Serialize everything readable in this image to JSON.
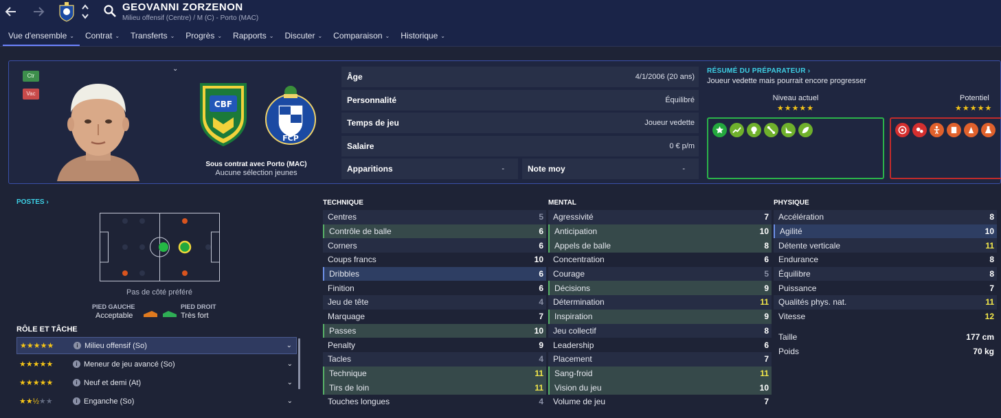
{
  "header": {
    "player_name": "GEOVANNI ZORZENON",
    "player_subtitle": "Milieu offensif (Centre) / M (C) - Porto (MAC)"
  },
  "tabs": [
    {
      "label": "Vue d'ensemble",
      "active": true
    },
    {
      "label": "Contrat"
    },
    {
      "label": "Transferts"
    },
    {
      "label": "Progrès"
    },
    {
      "label": "Rapports"
    },
    {
      "label": "Discuter"
    },
    {
      "label": "Comparaison"
    },
    {
      "label": "Historique"
    }
  ],
  "hero": {
    "badge_ctr": "Ctr",
    "badge_vac": "Vac",
    "flag_brazil_text": "CBF",
    "crest_porto_text": "FCP",
    "contract": "Sous contrat avec Porto (MAC)",
    "youth": "Aucune sélection jeunes"
  },
  "info": {
    "age_label": "Âge",
    "age_value": "4/1/2006 (20 ans)",
    "personality_label": "Personnalité",
    "personality_value": "Équilibré",
    "playtime_label": "Temps de jeu",
    "playtime_value": "Joueur vedette",
    "salary_label": "Salaire",
    "salary_value": "0 € p/m",
    "apps_label": "Apparitions",
    "apps_value": "-",
    "rating_label": "Note moy",
    "rating_value": "-"
  },
  "scout": {
    "title": "RÉSUMÉ DU PRÉPARATEUR",
    "summary": "Joueur vedette mais pourrait encore progresser",
    "current_label": "Niveau actuel",
    "current_stars": "★★★★★",
    "potential_label": "Potentiel",
    "potential_stars": "★★★★★",
    "strength_icons": [
      "star-icon",
      "trend-icon",
      "head-icon",
      "bone-icon",
      "boot-icon",
      "leaf-icon"
    ],
    "weakness_icons": [
      "target-icon",
      "ball-icon",
      "figure-icon",
      "document-icon",
      "cone-icon",
      "flask-icon"
    ]
  },
  "colors": {
    "strength": "#2bb34a",
    "weakness": "#c22b2b",
    "accent": "#3ed1e6",
    "highlight_value": "#f3e84a"
  },
  "positions": {
    "title": "POSTES",
    "no_side": "Pas de côté préféré",
    "left_foot_label": "PIED GAUCHE",
    "left_foot_value": "Acceptable",
    "right_foot_label": "PIED DROIT",
    "right_foot_value": "Très fort"
  },
  "roles": {
    "title": "RÔLE ET TÂCHE",
    "items": [
      {
        "name": "Milieu offensif (So)",
        "stars": 5,
        "active": true
      },
      {
        "name": "Meneur de jeu avancé (So)",
        "stars": 5
      },
      {
        "name": "Neuf et demi (At)",
        "stars": 5
      },
      {
        "name": "Enganche (So)",
        "stars": 2.5
      }
    ]
  },
  "technique": {
    "title": "TECHNIQUE",
    "rows": [
      {
        "name": "Centres",
        "value": "5",
        "tone": "low"
      },
      {
        "name": "Contrôle de balle",
        "value": "6",
        "hl": "green"
      },
      {
        "name": "Corners",
        "value": "6"
      },
      {
        "name": "Coups francs",
        "value": "10"
      },
      {
        "name": "Dribbles",
        "value": "6",
        "hl": "blue"
      },
      {
        "name": "Finition",
        "value": "6"
      },
      {
        "name": "Jeu de tête",
        "value": "4",
        "tone": "low"
      },
      {
        "name": "Marquage",
        "value": "7"
      },
      {
        "name": "Passes",
        "value": "10",
        "hl": "green"
      },
      {
        "name": "Penalty",
        "value": "9"
      },
      {
        "name": "Tacles",
        "value": "4",
        "tone": "low"
      },
      {
        "name": "Technique",
        "value": "11",
        "tone": "high",
        "hl": "green"
      },
      {
        "name": "Tirs de loin",
        "value": "11",
        "tone": "high",
        "hl": "green"
      },
      {
        "name": "Touches longues",
        "value": "4",
        "tone": "low"
      }
    ]
  },
  "mental": {
    "title": "MENTAL",
    "rows": [
      {
        "name": "Agressivité",
        "value": "7"
      },
      {
        "name": "Anticipation",
        "value": "10",
        "hl": "green"
      },
      {
        "name": "Appels de balle",
        "value": "8",
        "hl": "green"
      },
      {
        "name": "Concentration",
        "value": "6"
      },
      {
        "name": "Courage",
        "value": "5",
        "tone": "low"
      },
      {
        "name": "Décisions",
        "value": "9",
        "hl": "green"
      },
      {
        "name": "Détermination",
        "value": "11",
        "tone": "high"
      },
      {
        "name": "Inspiration",
        "value": "9",
        "hl": "green"
      },
      {
        "name": "Jeu collectif",
        "value": "8"
      },
      {
        "name": "Leadership",
        "value": "6"
      },
      {
        "name": "Placement",
        "value": "7"
      },
      {
        "name": "Sang-froid",
        "value": "11",
        "tone": "high",
        "hl": "green"
      },
      {
        "name": "Vision du jeu",
        "value": "10",
        "hl": "green"
      },
      {
        "name": "Volume de jeu",
        "value": "7"
      }
    ]
  },
  "physique": {
    "title": "PHYSIQUE",
    "rows": [
      {
        "name": "Accélération",
        "value": "8"
      },
      {
        "name": "Agilité",
        "value": "10",
        "hl": "blue"
      },
      {
        "name": "Détente verticale",
        "value": "11",
        "tone": "high"
      },
      {
        "name": "Endurance",
        "value": "8"
      },
      {
        "name": "Équilibre",
        "value": "8"
      },
      {
        "name": "Puissance",
        "value": "7"
      },
      {
        "name": "Qualités phys. nat.",
        "value": "11",
        "tone": "high"
      },
      {
        "name": "Vitesse",
        "value": "12",
        "tone": "high"
      }
    ],
    "height_label": "Taille",
    "height_value": "177 cm",
    "weight_label": "Poids",
    "weight_value": "70 kg"
  }
}
